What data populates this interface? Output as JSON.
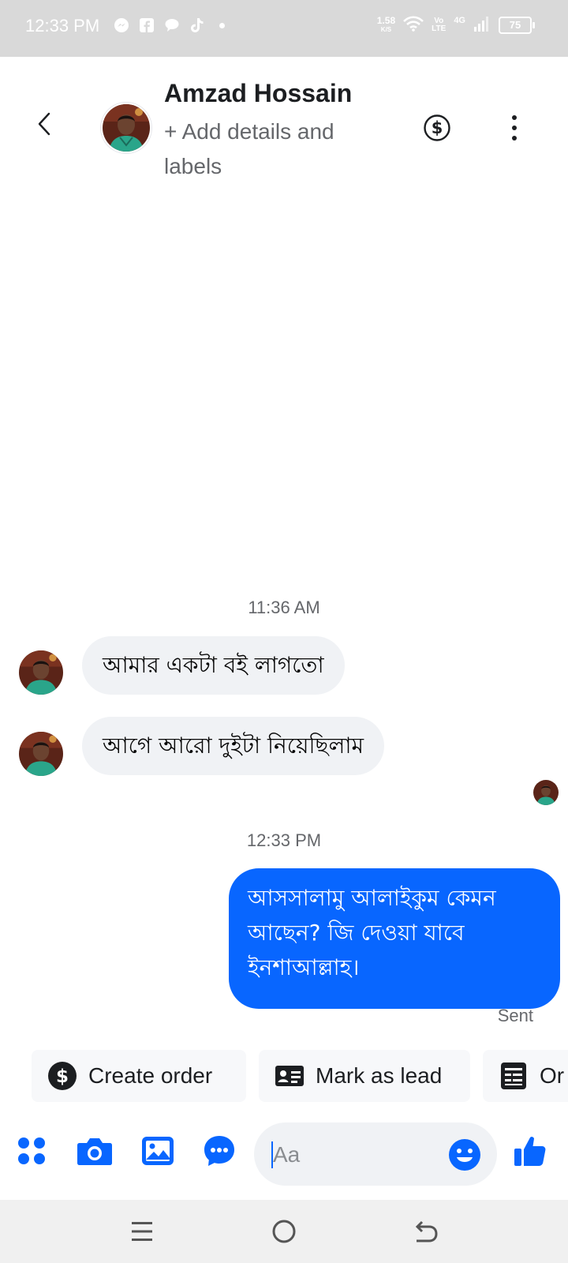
{
  "status_bar": {
    "time": "12:33 PM",
    "speed_value": "1.58",
    "speed_unit": "K/S",
    "volte_top": "Vo",
    "volte_bottom": "LTE",
    "network": "4G",
    "battery": "75",
    "notification_icons": [
      "messenger-icon",
      "facebook-icon",
      "chat-icon",
      "tiktok-icon",
      "dot-icon"
    ]
  },
  "header": {
    "contact_name": "Amzad Hossain",
    "add_details": "+ Add details and labels",
    "icons": [
      "back-arrow-icon",
      "dollar-circle-icon",
      "more-vertical-icon"
    ]
  },
  "conversation": {
    "timestamp_1": "11:36 AM",
    "incoming": [
      {
        "text": "আমার একটা বই লাগতো"
      },
      {
        "text": "আগে আরো দুইটা নিয়েছিলাম"
      }
    ],
    "timestamp_2": "12:33 PM",
    "outgoing": {
      "text": "আসসালামু আলাইকুম কেমন আছেন?  জি দেওয়া যাবে ইনশাআল্লাহ।",
      "status": "Sent"
    }
  },
  "quick_actions": [
    {
      "label": "Create order",
      "icon": "dollar-circle-icon"
    },
    {
      "label": "Mark as lead",
      "icon": "contact-card-icon"
    },
    {
      "label": "Or",
      "icon": "order-list-icon"
    }
  ],
  "composer": {
    "placeholder": "Aa",
    "icons": [
      "apps-icon",
      "camera-icon",
      "gallery-icon",
      "chat-bubble-icon",
      "emoji-icon",
      "thumbs-up-icon"
    ]
  },
  "colors": {
    "accent": "#0866ff",
    "incoming_bubble": "#f0f2f5",
    "status_bar": "#d9d9d9"
  }
}
